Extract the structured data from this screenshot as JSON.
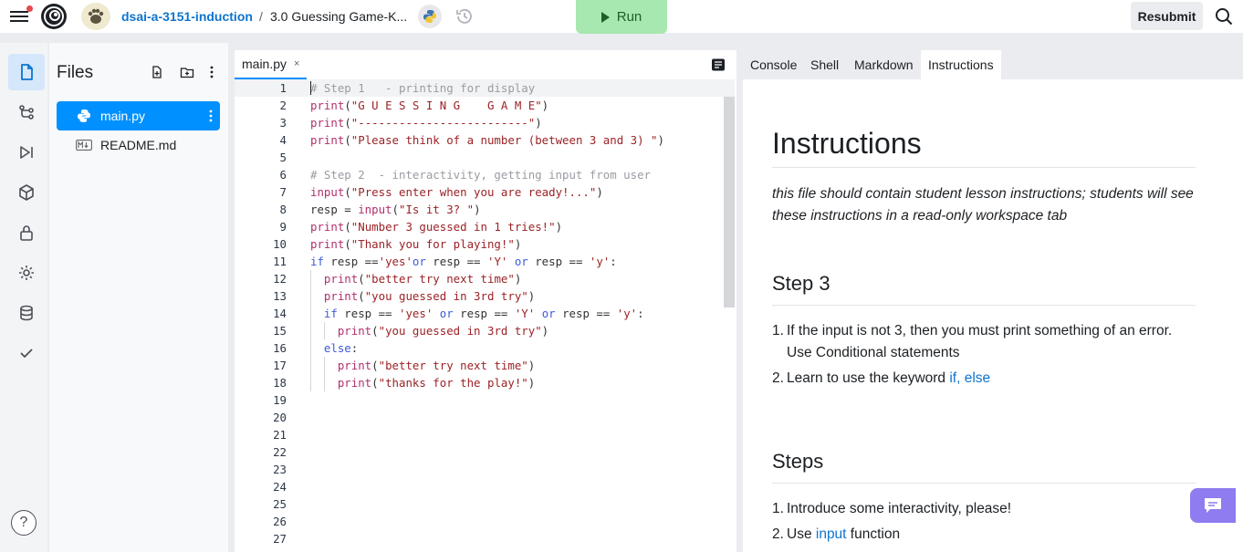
{
  "topbar": {
    "course": "dsai-a-3151-induction",
    "separator": "/",
    "assignment": "3.0 Guessing Game-K...",
    "run_label": "Run",
    "resubmit_label": "Resubmit"
  },
  "files": {
    "title": "Files",
    "items": [
      {
        "name": "main.py",
        "icon": "python-icon",
        "selected": true
      },
      {
        "name": "README.md",
        "icon": "markdown-icon",
        "selected": false
      }
    ]
  },
  "editor": {
    "tab_label": "main.py",
    "tab_close": "×",
    "current_line": 1,
    "line_numbers": [
      "1",
      "2",
      "3",
      "4",
      "5",
      "6",
      "7",
      "8",
      "9",
      "10",
      "11",
      "12",
      "13",
      "14",
      "15",
      "16",
      "17",
      "18",
      "19",
      "20",
      "21",
      "22",
      "23",
      "24",
      "25",
      "26",
      "27"
    ],
    "lines": [
      "# Step 1   - printing for display",
      "print(\"G U E S S I N G    G A M E\")",
      "print(\"-------------------------\")",
      "print(\"Please think of a number (between 3 and 3) \")",
      "",
      "# Step 2  - interactivity, getting input from user",
      "input(\"Press enter when you are ready!...\")",
      "resp = input(\"Is it 3? \")",
      "print(\"Number 3 guessed in 1 tries!\")",
      "print(\"Thank you for playing!\")",
      "if resp =='yes'or resp == 'Y' or resp == 'y':",
      "  print(\"better try next time\")",
      "  print(\"you guessed in 3rd try\")",
      "  if resp == 'yes' or resp == 'Y' or resp == 'y':",
      "    print(\"you guessed in 3rd try\")",
      "  else:",
      "    print(\"better try next time\")",
      "    print(\"thanks for the play!\")",
      "",
      "",
      "",
      "",
      "",
      "",
      "",
      "",
      ""
    ]
  },
  "right_tabs": [
    "Console",
    "Shell",
    "Markdown",
    "Instructions"
  ],
  "active_right_tab": "Instructions",
  "instructions": {
    "title": "Instructions",
    "intro": "this file should contain student lesson instructions; students will see these instructions in a read-only workspace tab",
    "step3_heading": "Step 3",
    "step3_items": [
      {
        "num": "1.",
        "text": "If the input is not 3, then you must print something of an error. Use Conditional statements"
      },
      {
        "num": "2.",
        "text": "Learn to use the keyword ",
        "link": "if, else"
      }
    ],
    "steps_heading": "Steps",
    "steps_items": [
      {
        "num": "1.",
        "text": "Introduce some interactivity, please!"
      },
      {
        "num": "2.",
        "text": "Use ",
        "link": "input",
        "after": " function"
      }
    ]
  },
  "help_label": "?",
  "colors": {
    "accent": "#0090ff",
    "run_bg": "#a7e8b0",
    "chat_bg": "#8e7cf0",
    "link": "#0d74ce"
  }
}
